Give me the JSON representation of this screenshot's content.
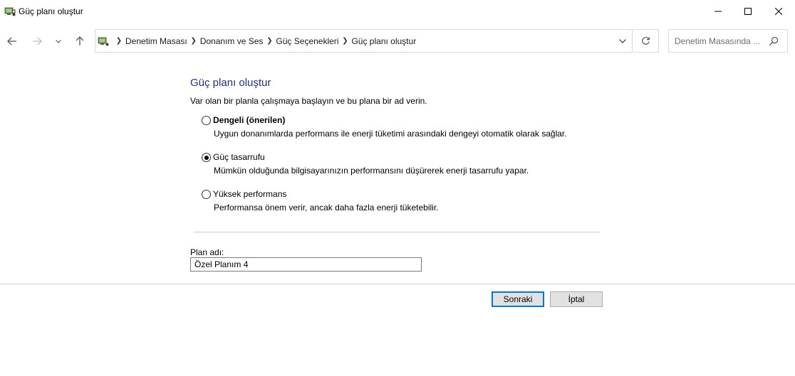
{
  "window": {
    "title": "Güç planı oluştur"
  },
  "address": {
    "breadcrumbs": [
      "Denetim Masası",
      "Donanım ve Ses",
      "Güç Seçenekleri",
      "Güç planı oluştur"
    ]
  },
  "search": {
    "placeholder": "Denetim Masasında ..."
  },
  "content": {
    "title": "Güç planı oluştur",
    "intro": "Var olan bir planla çalışmaya başlayın ve bu plana bir ad verin.",
    "options": [
      {
        "label": "Dengeli (önerilen)",
        "description": "Uygun donanımlarda performans ile enerji tüketimi arasındaki dengeyi otomatik olarak sağlar.",
        "checked": false
      },
      {
        "label": "Güç tasarrufu",
        "description": "Mümkün olduğunda bilgisayarınızın performansını düşürerek enerji tasarrufu yapar.",
        "checked": true
      },
      {
        "label": "Yüksek performans",
        "description": "Performansa önem verir, ancak daha fazla enerji tüketebilir.",
        "checked": false
      }
    ],
    "plan_name_label": "Plan adı:",
    "plan_name_value": "Özel Planım 4"
  },
  "buttons": {
    "next": "Sonraki",
    "cancel": "İptal"
  },
  "icons": {
    "app": "power-options-icon",
    "back": "arrow-left-icon",
    "forward": "arrow-right-icon",
    "recent": "chevron-down-icon",
    "up": "arrow-up-icon",
    "refresh": "refresh-icon",
    "search": "search-icon"
  },
  "colors": {
    "title": "#1e3287",
    "default_button_border": "#0078d7"
  }
}
